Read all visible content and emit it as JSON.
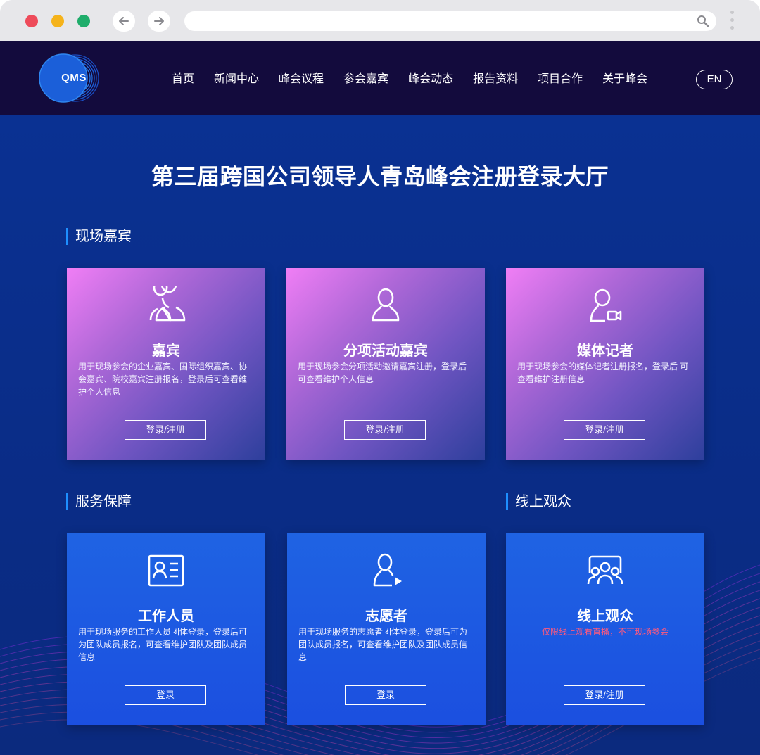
{
  "browser": {
    "traffic_lights": [
      "#ee4b5a",
      "#f5b31b",
      "#1fad6b"
    ],
    "back_icon": "arrow-left-icon",
    "forward_icon": "arrow-right-icon",
    "url": "",
    "search_icon": "search-icon",
    "menu_icon": "kebab-menu-icon"
  },
  "header": {
    "logo_text": "QMS",
    "nav": [
      "首页",
      "新闻中心",
      "峰会议程",
      "参会嘉宾",
      "峰会动态",
      "报告资料",
      "项目合作",
      "关于峰会"
    ],
    "lang_toggle": "EN"
  },
  "page_title": "第三届跨国公司领导人青岛峰会注册登录大厅",
  "sections": {
    "onsite": {
      "title": "现场嘉宾",
      "cards": [
        {
          "icon": "guests-group-icon",
          "title": "嘉宾",
          "desc": "用于现场参会的企业嘉宾、国际组织嘉宾、协会嘉宾、院校嘉宾注册报名，登录后可查看维护个人信息",
          "button": "登录/注册"
        },
        {
          "icon": "person-icon",
          "title": "分项活动嘉宾",
          "desc": "用于现场参会分项活动邀请嘉宾注册，登录后可查看维护个人信息",
          "button": "登录/注册"
        },
        {
          "icon": "journalist-camera-icon",
          "title": "媒体记者",
          "desc": "用于现场参会的媒体记者注册报名，登录后 可查看维护注册信息",
          "button": "登录/注册"
        }
      ]
    },
    "service": {
      "title": "服务保障",
      "cards": [
        {
          "icon": "id-card-icon",
          "title": "工作人员",
          "desc": "用于现场服务的工作人员团体登录，登录后可为团队成员报名，可查看维护团队及团队成员信息",
          "button": "登录"
        },
        {
          "icon": "volunteer-icon",
          "title": "志愿者",
          "desc": "用于现场服务的志愿者团体登录，登录后可为团队成员报名，可查看维护团队及团队成员信息",
          "button": "登录"
        }
      ]
    },
    "online": {
      "title": "线上观众",
      "cards": [
        {
          "icon": "online-audience-icon",
          "title": "线上观众",
          "desc": "仅限线上观看直播，不可现场参会",
          "button": "登录/注册"
        }
      ]
    }
  },
  "colors": {
    "header_bg": "#130b3d",
    "page_bg": "#0a2c82",
    "accent_bar": "#1e8fff",
    "card_blue": "#1b57e2",
    "online_note": "#ff5a7e"
  }
}
